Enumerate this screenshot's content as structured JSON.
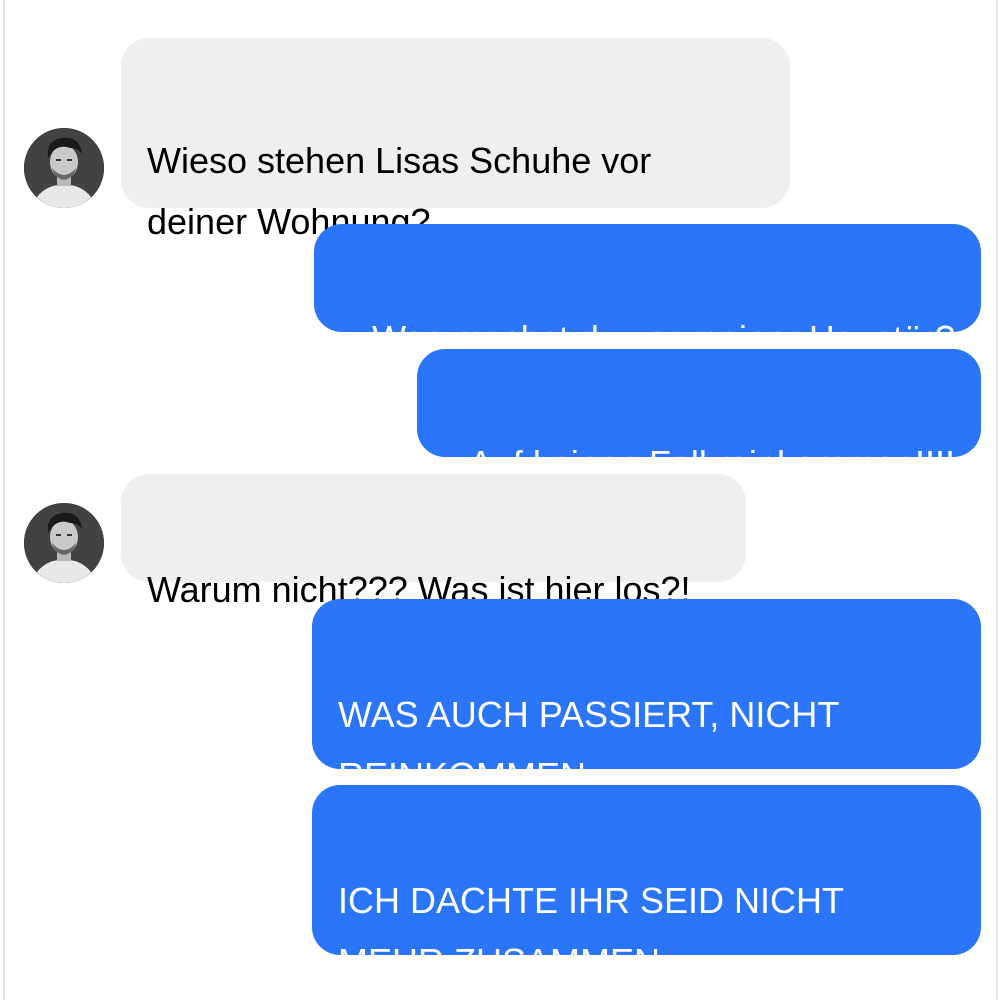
{
  "contact": {
    "avatar_icon": "user-avatar-photo"
  },
  "messages": [
    {
      "direction": "incoming",
      "text": "Wieso stehen Lisas Schuhe vor\ndeiner Wohnung?"
    },
    {
      "direction": "outgoing",
      "text": "Was machst du vor meiner Haustür?"
    },
    {
      "direction": "outgoing",
      "text": "Auf keinen Fall reinkommen!!!!"
    },
    {
      "direction": "incoming",
      "text": "Warum nicht??? Was ist hier los?!"
    },
    {
      "direction": "outgoing",
      "text": "WAS AUCH PASSIERT, NICHT\nREINKOMMEN"
    },
    {
      "direction": "outgoing",
      "text": "ICH DACHTE IHR SEID NICHT\nMEHR ZUSAMMEN"
    }
  ],
  "colors": {
    "outgoing_bubble": "#2a75f8",
    "incoming_bubble": "#efefef",
    "outgoing_text": "#ffffff",
    "incoming_text": "#000000"
  }
}
